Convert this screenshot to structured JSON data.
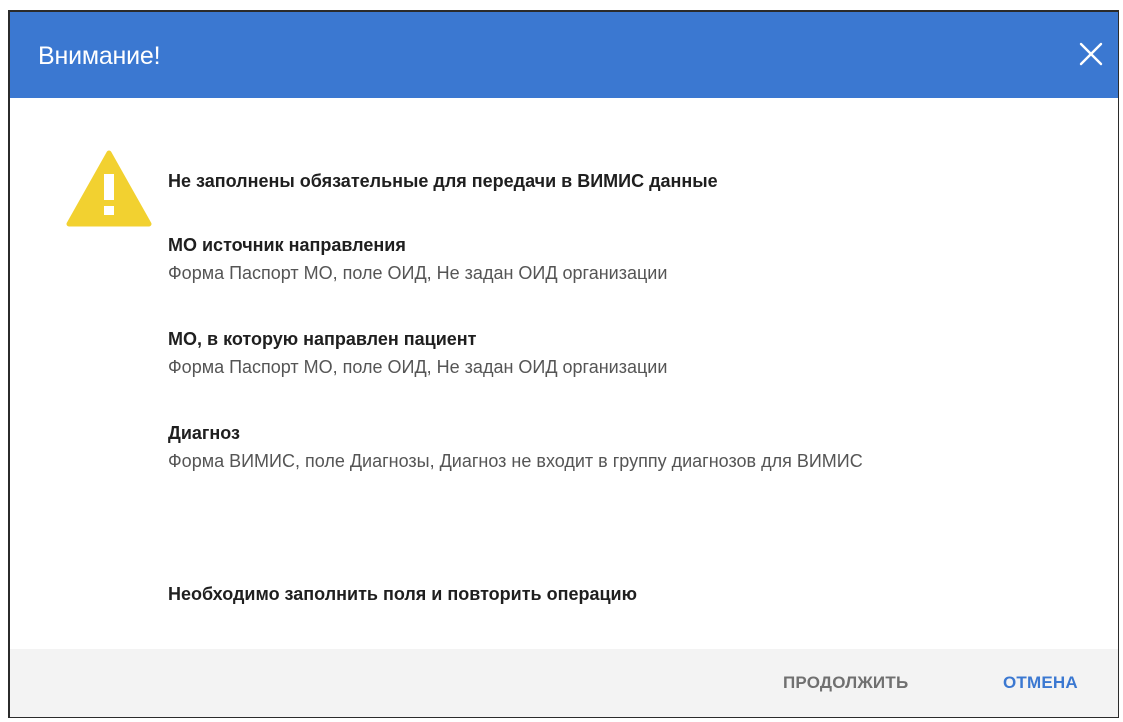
{
  "dialog": {
    "title": "Внимание!",
    "close_icon": "close-icon",
    "warning_icon": "warning-triangle-icon",
    "accent_color": "#3b78d1",
    "warning_color": "#f2d130"
  },
  "message": {
    "header": "Не заполнены обязательные для передачи в ВИМИС данные",
    "items": [
      {
        "title": "МО источник направления",
        "description": "Форма Паспорт МО, поле ОИД, Не задан ОИД организации"
      },
      {
        "title": "МО, в которую направлен пациент",
        "description": "Форма Паспорт МО, поле ОИД, Не задан ОИД организации"
      },
      {
        "title": "Диагноз",
        "description": "Форма ВИМИС, поле Диагнозы, Диагноз не входит в группу диагнозов для ВИМИС"
      }
    ],
    "footer_note": "Необходимо заполнить поля и повторить операцию"
  },
  "buttons": {
    "continue_label": "ПРОДОЛЖИТЬ",
    "cancel_label": "ОТМЕНА"
  }
}
